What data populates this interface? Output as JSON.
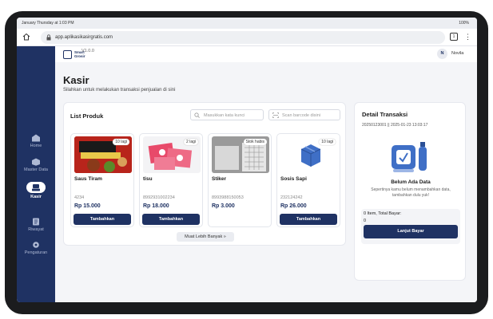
{
  "status_bar": {
    "time": "January Thursday at 1:03 PM",
    "battery": "100%"
  },
  "browser": {
    "url": "app.aplikasikasirgratis.com",
    "tabs_count": "1"
  },
  "sidebar": {
    "items": [
      {
        "label": "Home",
        "icon": "home-icon"
      },
      {
        "label": "Master Data",
        "icon": "box-icon"
      },
      {
        "label": "Kasir",
        "icon": "cashier-icon",
        "active": true
      },
      {
        "label": "Riwayat",
        "icon": "history-icon"
      },
      {
        "label": "Pengaturan",
        "icon": "gear-icon"
      }
    ]
  },
  "header": {
    "logo_text": "Smart Grosir",
    "version": "V1.0.0",
    "avatar_initial": "N",
    "user_name": "Novila"
  },
  "page": {
    "title": "Kasir",
    "subtitle": "Silahkan untuk melakukan transaksi penjualan di sini"
  },
  "products": {
    "title": "List Produk",
    "search_placeholder": "Masukkan kata kunci",
    "scan_placeholder": "Scan barcode disini",
    "add_label": "Tambahkan",
    "more_label": "Muat Lebih Banyak",
    "items": [
      {
        "name": "Saus Tiram",
        "code": "4234",
        "price": "Rp 15.000",
        "stock": "10 lagi"
      },
      {
        "name": "tisu",
        "code": "8992931002234",
        "price": "Rp 18.000",
        "stock": "2 lagi"
      },
      {
        "name": "Stiker",
        "code": "8993988150053",
        "price": "Rp 3.000",
        "stock": "Stok habis"
      },
      {
        "name": "Sosis Sapi",
        "code": "232124242",
        "price": "Rp 26.000",
        "stock": "10 lagi"
      }
    ]
  },
  "detail": {
    "title": "Detail Transaksi",
    "meta": "20250123001 || 2025-01-23 13:03:17",
    "empty_title": "Belum Ada Data",
    "empty_desc": "Sepertinya kamu belum menambahkan data, tambahkan dulu yuk!",
    "summary": "0 Item, Total Bayar:",
    "total": "0",
    "pay_label": "Lanjut Bayar"
  },
  "colors": {
    "primary": "#1f3263",
    "background": "#f4f5f8"
  }
}
